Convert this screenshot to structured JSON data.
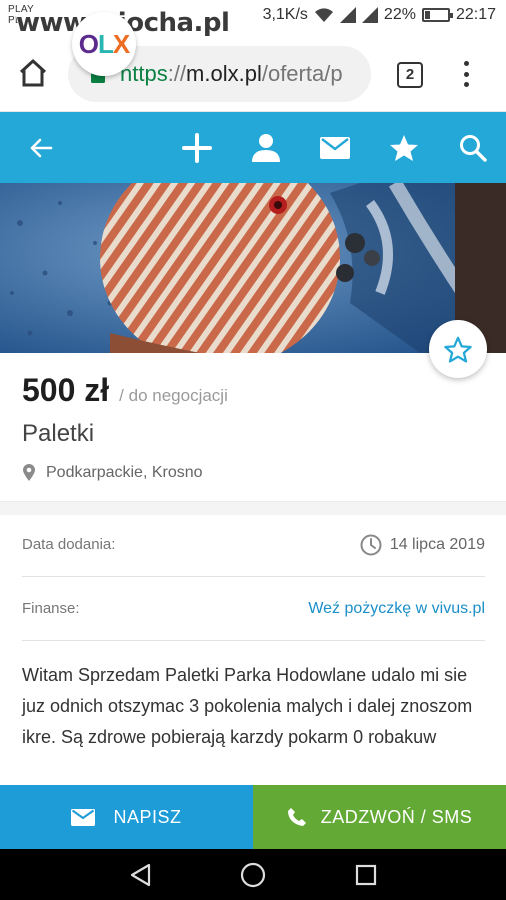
{
  "status_bar": {
    "carrier_line1": "PLAY",
    "carrier_line2": "PL",
    "watermark": "www.wiocha.pl",
    "speed": "3,1K/s",
    "battery": "22%",
    "battery_level": 0.22,
    "time": "22:17"
  },
  "browser": {
    "url_scheme": "https",
    "url_sep": "://",
    "url_host": "m.olx.pl",
    "url_path": "/oferta/p",
    "tab_count": "2",
    "icons": {
      "home": "home-icon",
      "lock": "lock-icon",
      "menu": "more-vert-icon"
    }
  },
  "header": {
    "logo": {
      "o": "O",
      "l": "L",
      "x": "X"
    },
    "icons": [
      "back-arrow-icon",
      "add-icon",
      "user-icon",
      "mail-icon",
      "star-icon",
      "search-icon"
    ],
    "colors": {
      "background": "#23a8d8",
      "logo_o": "#5b2b8e",
      "logo_l": "#2ab6b0",
      "logo_x": "#ef6d23"
    }
  },
  "listing": {
    "price": "500 zł",
    "negotiable": "/ do negocjacji",
    "title": "Paletki",
    "location": "Podkarpackie, Krosno",
    "date_label": "Data dodania:",
    "date_value": "14 lipca 2019",
    "finance_label": "Finanse:",
    "finance_link": "Weź pożyczkę w vivus.pl",
    "description": "Witam Sprzedam Paletki Parka Hodowlane udalo mi sie juz odnich otszymac 3 pokolenia malych i dalej znoszom ikre. Są zdrowe pobierają karzdy  pokarm 0 robakuw"
  },
  "actions": {
    "write_label": "NAPISZ",
    "call_label": "ZADZWOŃ / SMS",
    "colors": {
      "write": "#1d9cd8",
      "call": "#63a935"
    }
  },
  "nav": {
    "icons": [
      "back-triangle-icon",
      "home-circle-icon",
      "recents-square-icon"
    ]
  }
}
